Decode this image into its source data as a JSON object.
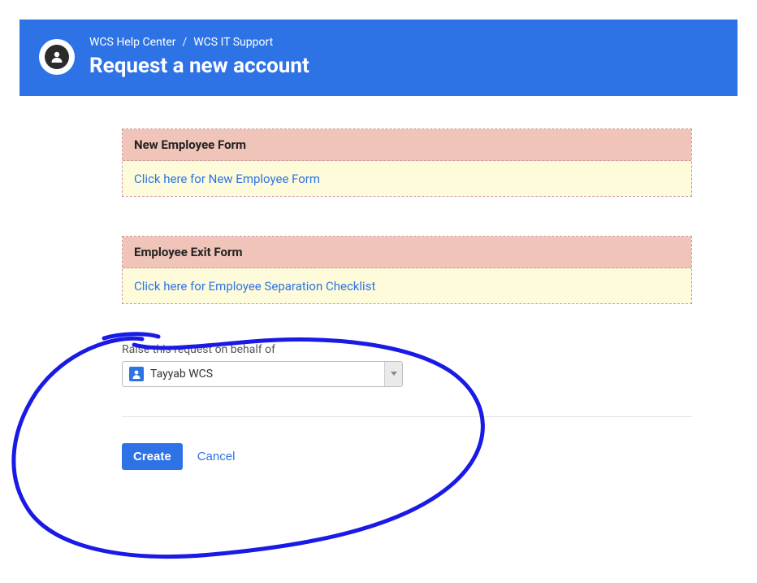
{
  "breadcrumb": {
    "root": "WCS Help Center",
    "current": "WCS IT Support",
    "sep": "/"
  },
  "page_title": "Request a new account",
  "panels": [
    {
      "title": "New Employee Form",
      "link_text": "Click here for New Employee Form"
    },
    {
      "title": "Employee Exit Form",
      "link_text": "Click here for Employee Separation Checklist"
    }
  ],
  "form": {
    "behalf_label": "Raise this request on behalf of",
    "behalf_value": "Tayyab WCS"
  },
  "actions": {
    "create_label": "Create",
    "cancel_label": "Cancel"
  },
  "annotation_color": "#1a1ae6"
}
